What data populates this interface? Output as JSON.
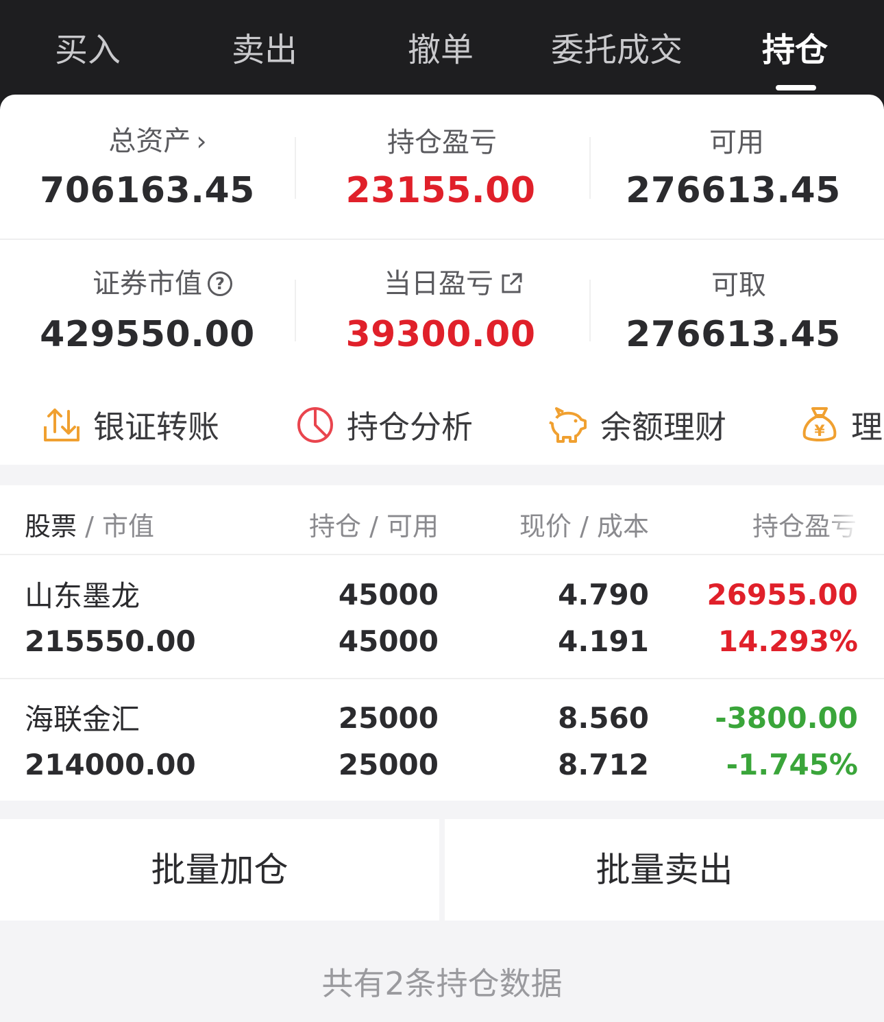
{
  "tabs": [
    {
      "label": "买入",
      "active": false
    },
    {
      "label": "卖出",
      "active": false
    },
    {
      "label": "撤单",
      "active": false
    },
    {
      "label": "委托成交",
      "active": false
    },
    {
      "label": "持仓",
      "active": true
    }
  ],
  "summary": {
    "total_assets": {
      "label": "总资产",
      "value": "706163.45"
    },
    "position_pnl": {
      "label": "持仓盈亏",
      "value": "23155.00"
    },
    "available": {
      "label": "可用",
      "value": "276613.45"
    },
    "market_value": {
      "label": "证券市值",
      "value": "429550.00"
    },
    "daily_pnl": {
      "label": "当日盈亏",
      "value": "39300.00"
    },
    "withdrawable": {
      "label": "可取",
      "value": "276613.45"
    }
  },
  "shortcuts": [
    {
      "label": "银证转账",
      "icon": "transfer-icon",
      "color": "#f0a030"
    },
    {
      "label": "持仓分析",
      "icon": "pie-chart-icon",
      "color": "#e9454e"
    },
    {
      "label": "余额理财",
      "icon": "piggy-bank-icon",
      "color": "#f0a030"
    },
    {
      "label": "理财",
      "icon": "money-bag-icon",
      "color": "#f0a030"
    }
  ],
  "table": {
    "headers": {
      "stock": "股票",
      "market_value": "市值",
      "position": "持仓",
      "available": "可用",
      "price": "现价",
      "cost": "成本",
      "pnl": "持仓盈亏"
    },
    "rows": [
      {
        "name": "山东墨龙",
        "market_value": "215550.00",
        "position": "45000",
        "available": "45000",
        "price": "4.790",
        "cost": "4.191",
        "pnl": "26955.00",
        "pnl_pct": "14.293%",
        "trend": "up"
      },
      {
        "name": "海联金汇",
        "market_value": "214000.00",
        "position": "25000",
        "available": "25000",
        "price": "8.560",
        "cost": "8.712",
        "pnl": "-3800.00",
        "pnl_pct": "-1.745%",
        "trend": "down"
      }
    ]
  },
  "actions": {
    "batch_add": "批量加仓",
    "batch_sell": "批量卖出"
  },
  "footer": "共有2条持仓数据",
  "colors": {
    "up": "#e0202a",
    "down": "#3aa53a",
    "tabbar": "#1e1e20"
  }
}
